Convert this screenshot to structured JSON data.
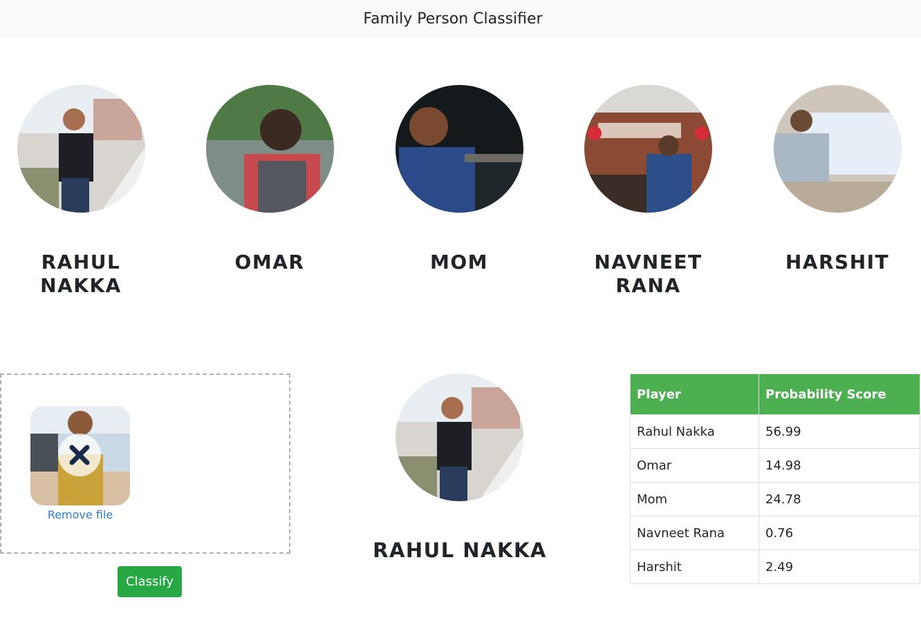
{
  "navbar": {
    "title": "Family Person Classifier"
  },
  "people": [
    {
      "name": "Rahul Nakka"
    },
    {
      "name": "Omar"
    },
    {
      "name": "Mom"
    },
    {
      "name": "Navneet Rana"
    },
    {
      "name": "Harshit"
    }
  ],
  "upload": {
    "remove_label": "Remove file"
  },
  "classify_button": "Classify",
  "result": {
    "name": "RAHUL NAKKA"
  },
  "score_table": {
    "headers": [
      "Player",
      "Probability Score"
    ],
    "rows": [
      [
        "Rahul Nakka",
        "56.99"
      ],
      [
        "Omar",
        "14.98"
      ],
      [
        "Mom",
        "24.78"
      ],
      [
        "Navneet Rana",
        "0.76"
      ],
      [
        "Harshit",
        "2.49"
      ]
    ]
  },
  "colors": {
    "accent_green": "#28a745",
    "table_header": "#4caf50",
    "link_blue": "#2a7fd4"
  }
}
